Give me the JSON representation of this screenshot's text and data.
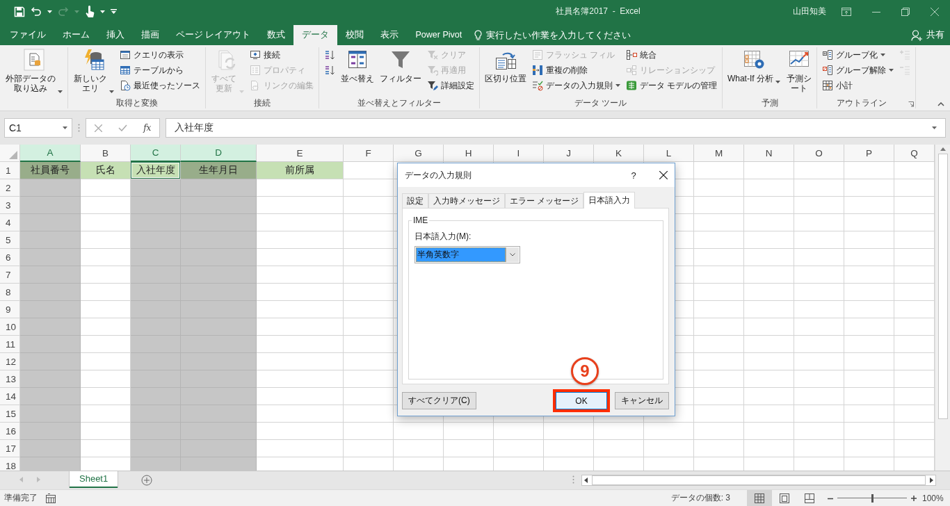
{
  "title_bar": {
    "title": "社員名簿2017  -  Excel",
    "user": "山田知美"
  },
  "ribbon_tabs": [
    {
      "label": "ファイル",
      "selected": false
    },
    {
      "label": "ホーム",
      "selected": false
    },
    {
      "label": "挿入",
      "selected": false
    },
    {
      "label": "描画",
      "selected": false
    },
    {
      "label": "ページ レイアウト",
      "selected": false
    },
    {
      "label": "数式",
      "selected": false
    },
    {
      "label": "データ",
      "selected": true
    },
    {
      "label": "校閲",
      "selected": false
    },
    {
      "label": "表示",
      "selected": false
    },
    {
      "label": "Power Pivot",
      "selected": false
    }
  ],
  "tell_me": {
    "placeholder": "実行したい作業を入力してください"
  },
  "share": {
    "label": "共有"
  },
  "ribbon_groups": [
    {
      "columns": [
        {
          "kind": "large",
          "label": "外部データの取り込み",
          "dropdown": true,
          "disabled": false
        }
      ]
    },
    {
      "label": "取得と変換",
      "columns": [
        {
          "kind": "large",
          "label": "新しいクエリ",
          "dropdown": true,
          "disabled": false
        },
        {
          "kind": "stack",
          "items": [
            {
              "label": "クエリの表示",
              "disabled": false,
              "dropdown": false
            },
            {
              "label": "テーブルから",
              "disabled": false,
              "dropdown": false
            },
            {
              "label": "最近使ったソース",
              "disabled": false,
              "dropdown": false
            }
          ]
        }
      ]
    },
    {
      "label": "接続",
      "columns": [
        {
          "kind": "large",
          "label": "すべて更新",
          "dropdown": true,
          "disabled": true
        },
        {
          "kind": "stack",
          "items": [
            {
              "label": "接続",
              "disabled": false,
              "dropdown": false
            },
            {
              "label": "プロパティ",
              "disabled": true,
              "dropdown": false
            },
            {
              "label": "リンクの編集",
              "disabled": true,
              "dropdown": false
            }
          ]
        }
      ]
    },
    {
      "label": "並べ替えとフィルター",
      "columns": [
        {
          "kind": "stack",
          "items": [
            {
              "disabled": false,
              "dropdown": false
            },
            {
              "disabled": false,
              "dropdown": false
            }
          ]
        },
        {
          "kind": "large",
          "label": "並べ替え",
          "dropdown": false,
          "disabled": false
        },
        {
          "kind": "large",
          "label": "フィルター",
          "dropdown": false,
          "disabled": false
        },
        {
          "kind": "stack",
          "items": [
            {
              "label": "クリア",
              "disabled": true,
              "dropdown": false
            },
            {
              "label": "再適用",
              "disabled": true,
              "dropdown": false
            },
            {
              "label": "詳細設定",
              "disabled": false,
              "dropdown": false
            }
          ]
        }
      ]
    },
    {
      "label": "データ ツール",
      "columns": [
        {
          "kind": "large",
          "label": "区切り位置",
          "dropdown": false,
          "disabled": false
        },
        {
          "kind": "stack",
          "items": [
            {
              "label": "フラッシュ フィル",
              "disabled": true,
              "dropdown": false
            },
            {
              "label": "重複の削除",
              "disabled": false,
              "dropdown": false
            },
            {
              "label": "データの入力規則",
              "disabled": false,
              "dropdown": true
            }
          ]
        },
        {
          "kind": "stack",
          "items": [
            {
              "label": "統合",
              "disabled": false,
              "dropdown": false
            },
            {
              "label": "リレーションシップ",
              "disabled": true,
              "dropdown": false
            },
            {
              "label": "データ モデルの管理",
              "disabled": false,
              "dropdown": false
            }
          ]
        }
      ]
    },
    {
      "label": "予測",
      "columns": [
        {
          "kind": "large",
          "label": "What-If 分析",
          "dropdown": true,
          "disabled": false
        },
        {
          "kind": "large",
          "label": "予測シート",
          "dropdown": false,
          "disabled": false
        }
      ]
    },
    {
      "label": "アウトライン",
      "launcher": true,
      "columns": [
        {
          "kind": "stack",
          "items": [
            {
              "label": "グループ化",
              "disabled": false,
              "dropdown": true
            },
            {
              "label": "グループ解除",
              "disabled": false,
              "dropdown": true
            },
            {
              "label": "小計",
              "disabled": false,
              "dropdown": false
            }
          ]
        },
        {
          "kind": "stack",
          "items": [
            {
              "disabled": true,
              "dropdown": false
            },
            {
              "disabled": true,
              "dropdown": false
            }
          ]
        }
      ]
    }
  ],
  "formula_bar": {
    "name_box": "C1",
    "function_label": "fx",
    "value": "入社年度"
  },
  "sheet": {
    "columns": [
      {
        "label": "A",
        "selected": true
      },
      {
        "label": "B",
        "selected": false
      },
      {
        "label": "C",
        "selected": true
      },
      {
        "label": "D",
        "selected": true
      },
      {
        "label": "E",
        "selected": false
      },
      {
        "label": "F",
        "selected": false
      },
      {
        "label": "G",
        "selected": false
      },
      {
        "label": "H",
        "selected": false
      },
      {
        "label": "I",
        "selected": false
      },
      {
        "label": "J",
        "selected": false
      },
      {
        "label": "K",
        "selected": false
      },
      {
        "label": "L",
        "selected": false
      },
      {
        "label": "M",
        "selected": false
      },
      {
        "label": "N",
        "selected": false
      },
      {
        "label": "O",
        "selected": false
      },
      {
        "label": "P",
        "selected": false
      },
      {
        "label": "Q",
        "selected": false
      }
    ],
    "rows": [
      {
        "label": "1",
        "cells": [
          {
            "text": "社員番号",
            "filled": true,
            "active": false
          },
          {
            "text": "氏名",
            "filled": true,
            "active": false
          },
          {
            "text": "入社年度",
            "filled": true,
            "active": true
          },
          {
            "text": "生年月日",
            "filled": true,
            "active": false
          },
          {
            "text": "前所属",
            "filled": true,
            "active": false
          }
        ]
      },
      {
        "label": "2"
      },
      {
        "label": "3"
      },
      {
        "label": "4"
      },
      {
        "label": "5"
      },
      {
        "label": "6"
      },
      {
        "label": "7"
      },
      {
        "label": "8"
      },
      {
        "label": "9"
      },
      {
        "label": "10"
      },
      {
        "label": "11"
      },
      {
        "label": "12"
      },
      {
        "label": "13"
      },
      {
        "label": "14"
      },
      {
        "label": "15"
      },
      {
        "label": "16"
      },
      {
        "label": "17"
      },
      {
        "label": "18"
      }
    ]
  },
  "sheet_tabs": [
    {
      "label": "Sheet1",
      "selected": true
    }
  ],
  "status_bar": {
    "status": "準備完了",
    "summary": "データの個数: 3",
    "views": [
      {
        "selected": true
      },
      {
        "selected": false
      },
      {
        "selected": false
      }
    ],
    "zoom": {
      "level": 0.5,
      "reading": "100%"
    }
  },
  "dialog": {
    "title": "データの入力規則",
    "help": "?",
    "tabs": [
      {
        "label": "設定",
        "selected": false
      },
      {
        "label": "入力時メッセージ",
        "selected": false
      },
      {
        "label": "エラー メッセージ",
        "selected": false
      },
      {
        "label": "日本語入力",
        "selected": true
      }
    ],
    "group_label": "IME",
    "field_label": "日本語入力(M):",
    "dropdown": {
      "value": "半角英数字"
    },
    "buttons": [
      {
        "label": "すべてクリア(C)",
        "kind": "clear",
        "highlighted": false
      },
      {
        "label": "OK",
        "kind": "ok",
        "highlighted": true
      },
      {
        "label": "キャンセル",
        "kind": "cancel",
        "highlighted": false
      }
    ],
    "step_marker": "9"
  }
}
